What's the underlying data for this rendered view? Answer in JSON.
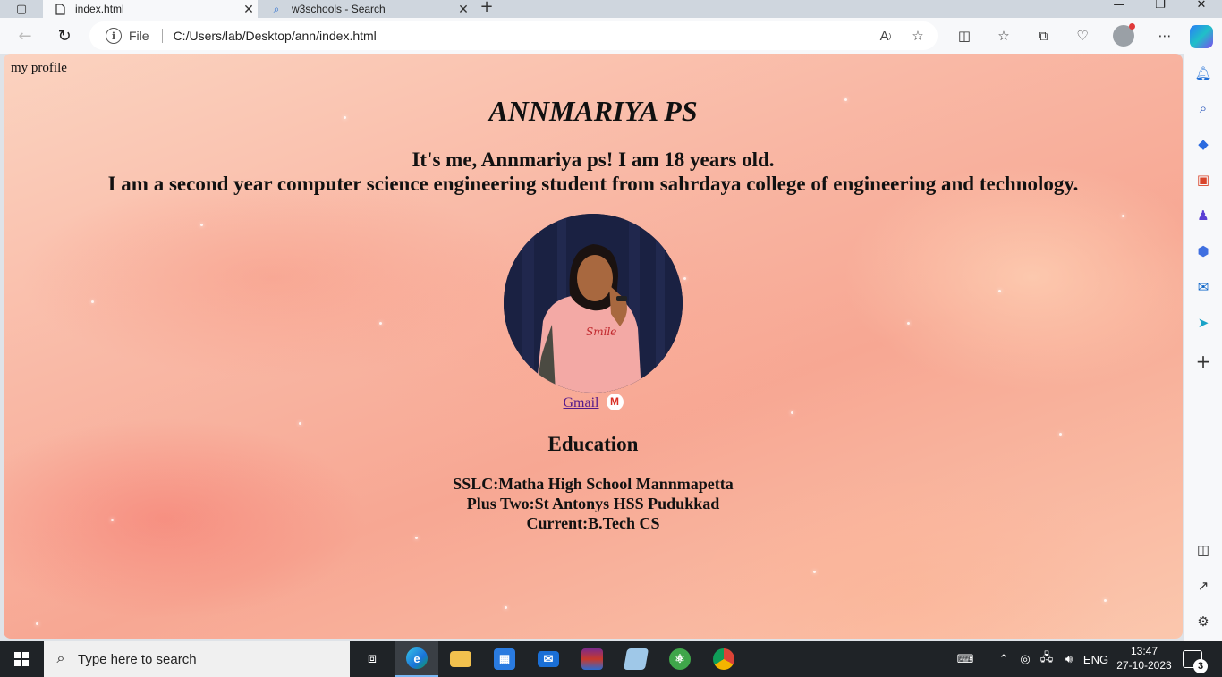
{
  "browser": {
    "tabs": [
      {
        "title": "index.html",
        "active": true,
        "icon": "page-icon"
      },
      {
        "title": "w3schools - Search",
        "active": false,
        "icon": "search-icon"
      }
    ],
    "address": {
      "scheme_label": "File",
      "url": "C:/Users/lab/Desktop/ann/index.html"
    },
    "toolbar_icons": [
      "read-aloud-icon",
      "favorite-star-icon",
      "split-screen-icon",
      "favorites-icon",
      "collections-icon",
      "browser-essentials-icon",
      "profile-icon",
      "more-icon",
      "copilot-icon"
    ],
    "sidebar_icons": [
      "bell-icon",
      "search-icon",
      "shopping-tag-icon",
      "toolbox-icon",
      "games-icon",
      "office-icon",
      "outlook-icon",
      "send-icon",
      "add-icon",
      "hide-sidebar-icon",
      "external-open-icon",
      "settings-icon"
    ]
  },
  "page": {
    "site_name": "my profile",
    "title": "ANNMARIYA PS",
    "intro_line1": "It's me, Annmariya ps! I am 18 years old.",
    "intro_line2": "I am a second year computer science engineering student from sahrdaya college of engineering and technology.",
    "gmail_link": "Gmail",
    "gmail_badge": "M",
    "education_heading": "Education",
    "education": [
      "SSLC:Matha High School Mannmapetta",
      "Plus Two:St Antonys HSS Pudukkad",
      "Current:B.Tech CS"
    ]
  },
  "taskbar": {
    "search_placeholder": "Type here to search",
    "apps": [
      "task-view-icon",
      "edge-icon",
      "file-explorer-icon",
      "store-icon",
      "mail-icon",
      "winrar-icon",
      "notepad-icon",
      "atom-icon",
      "chrome-icon"
    ],
    "language": "ENG",
    "time": "13:47",
    "date": "27-10-2023",
    "notification_count": "3"
  },
  "colors": {
    "link_visited": "#551a8b",
    "taskbar_bg": "#1f2327",
    "accent_blue": "#0078d4"
  }
}
